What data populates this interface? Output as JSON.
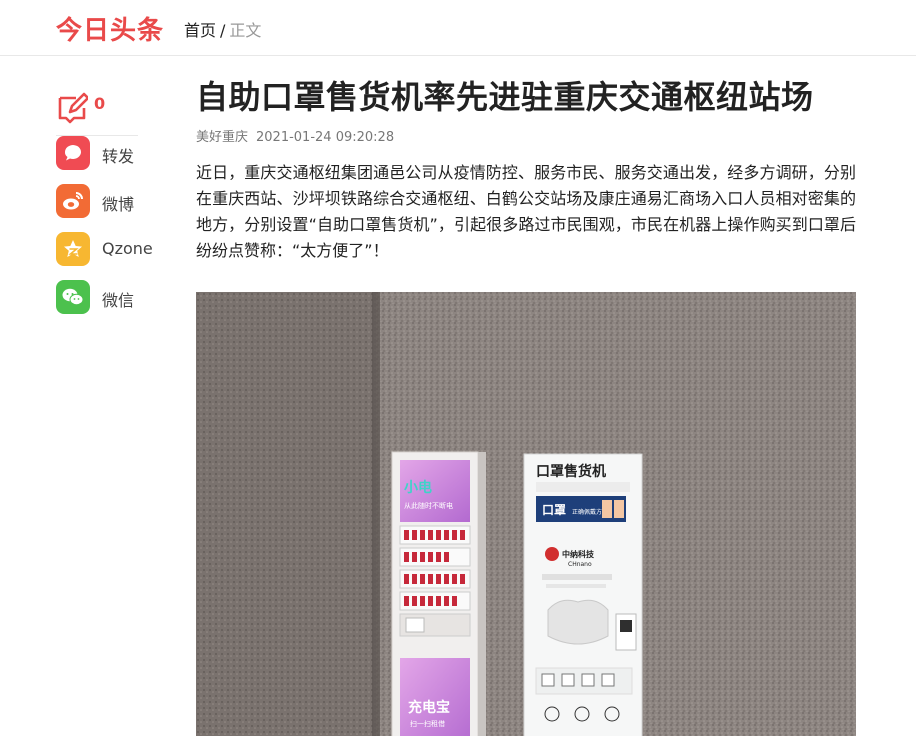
{
  "header": {
    "logo": "今日头条",
    "breadcrumb": {
      "home": "首页",
      "separator": "/",
      "current": "正文"
    }
  },
  "sidebar": {
    "comment_count": "0",
    "share_items": [
      {
        "label": "转发",
        "icon": "repost-icon",
        "color": "#f04b53"
      },
      {
        "label": "微博",
        "icon": "weibo-icon",
        "color": "#f26b35"
      },
      {
        "label": "Qzone",
        "icon": "qzone-icon",
        "color": "#f7b731"
      },
      {
        "label": "微信",
        "icon": "wechat-icon",
        "color": "#4cc14d"
      }
    ]
  },
  "article": {
    "title": "自助口罩售货机率先进驻重庆交通枢纽站场",
    "source": "美好重庆",
    "date": "2021-01-24 09:20:28",
    "paragraph": "近日，重庆交通枢纽集团通邑公司从疫情防控、服务市民、服务交通出发，经多方调研，分别在重庆西站、沙坪坝铁路综合交通枢纽、白鹤公交站场及康庄通易汇商场入口人员相对密集的地方，分别设置“自助口罩售货机”，引起很多路过市民围观，市民在机器上操作购买到口罩后纷纷点赞称：“太方便了”！"
  },
  "photo": {
    "left_screen_text": "小电",
    "left_screen_subtext": "从此随时不断电",
    "left_bottom_screen_text": "充电宝",
    "left_bottom_screen_subtext": "扫一扫租借",
    "machine_title": "口罩售货机",
    "machine_banner": "口罩",
    "machine_banner_sub": "正确佩戴方法",
    "brand": "中纳科技",
    "brand_en": "CHnano"
  },
  "colors": {
    "accent": "#e94a4a"
  }
}
